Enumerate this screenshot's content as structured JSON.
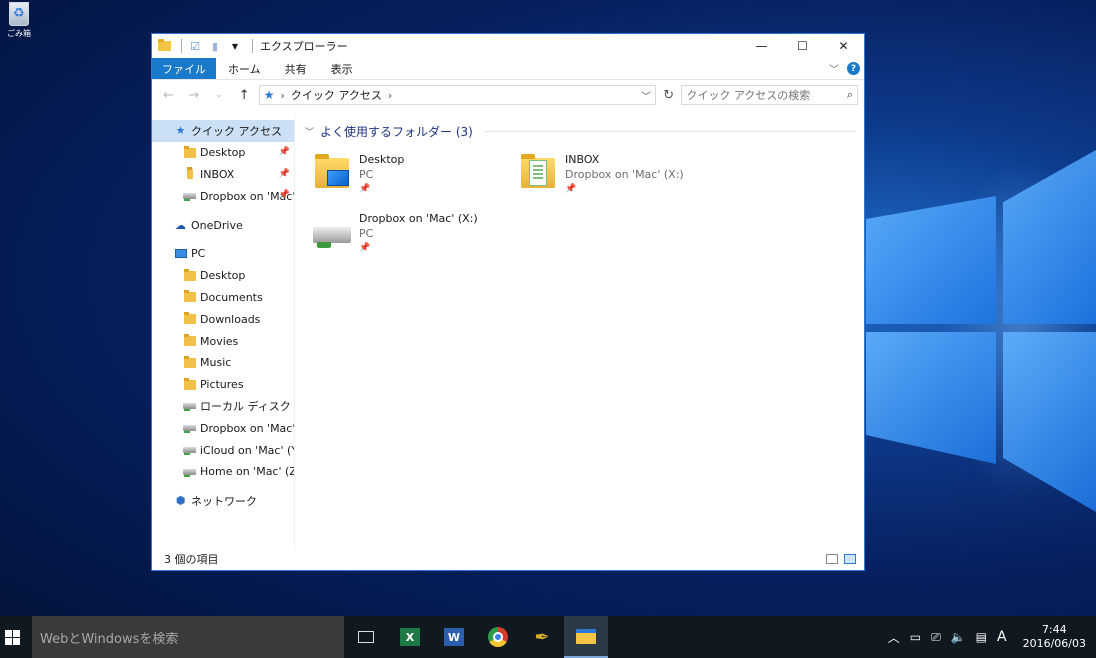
{
  "desktop": {
    "recycle_bin_label": "ごみ箱"
  },
  "window": {
    "title": "エクスプローラー",
    "controls": {
      "minimize": "—",
      "maximize": "☐",
      "close": "✕"
    }
  },
  "ribbon": {
    "tabs": [
      {
        "label": "ファイル"
      },
      {
        "label": "ホーム"
      },
      {
        "label": "共有"
      },
      {
        "label": "表示"
      }
    ],
    "help": "?"
  },
  "address_bar": {
    "path": "クイック アクセス",
    "search_placeholder": "クイック アクセスの検索"
  },
  "nav_pane": {
    "quick_access": "クイック アクセス",
    "quick_items": [
      {
        "label": "Desktop"
      },
      {
        "label": "INBOX"
      },
      {
        "label": "Dropbox on 'Mac' (X:)"
      }
    ],
    "onedrive": "OneDrive",
    "pc": "PC",
    "pc_items": [
      {
        "label": "Desktop"
      },
      {
        "label": "Documents"
      },
      {
        "label": "Downloads"
      },
      {
        "label": "Movies"
      },
      {
        "label": "Music"
      },
      {
        "label": "Pictures"
      },
      {
        "label": "ローカル ディスク (C:)"
      },
      {
        "label": "Dropbox on 'Mac' (X:)"
      },
      {
        "label": "iCloud on 'Mac' (Y:)"
      },
      {
        "label": "Home on 'Mac' (Z:)"
      }
    ],
    "network": "ネットワーク"
  },
  "content": {
    "group_title": "よく使用するフォルダー (3)",
    "tiles": [
      {
        "name": "Desktop",
        "location": "PC"
      },
      {
        "name": "INBOX",
        "location": "Dropbox on 'Mac' (X:)"
      },
      {
        "name": "Dropbox on 'Mac' (X:)",
        "location": "PC"
      }
    ]
  },
  "status": {
    "item_count": "3 個の項目"
  },
  "taskbar": {
    "search_placeholder": "WebとWindowsを検索",
    "ime": "A",
    "time": "7:44",
    "date": "2016/06/03"
  },
  "colors": {
    "accent": "#1979ca",
    "selection": "#cce0f5",
    "group_title": "#1e3287"
  }
}
